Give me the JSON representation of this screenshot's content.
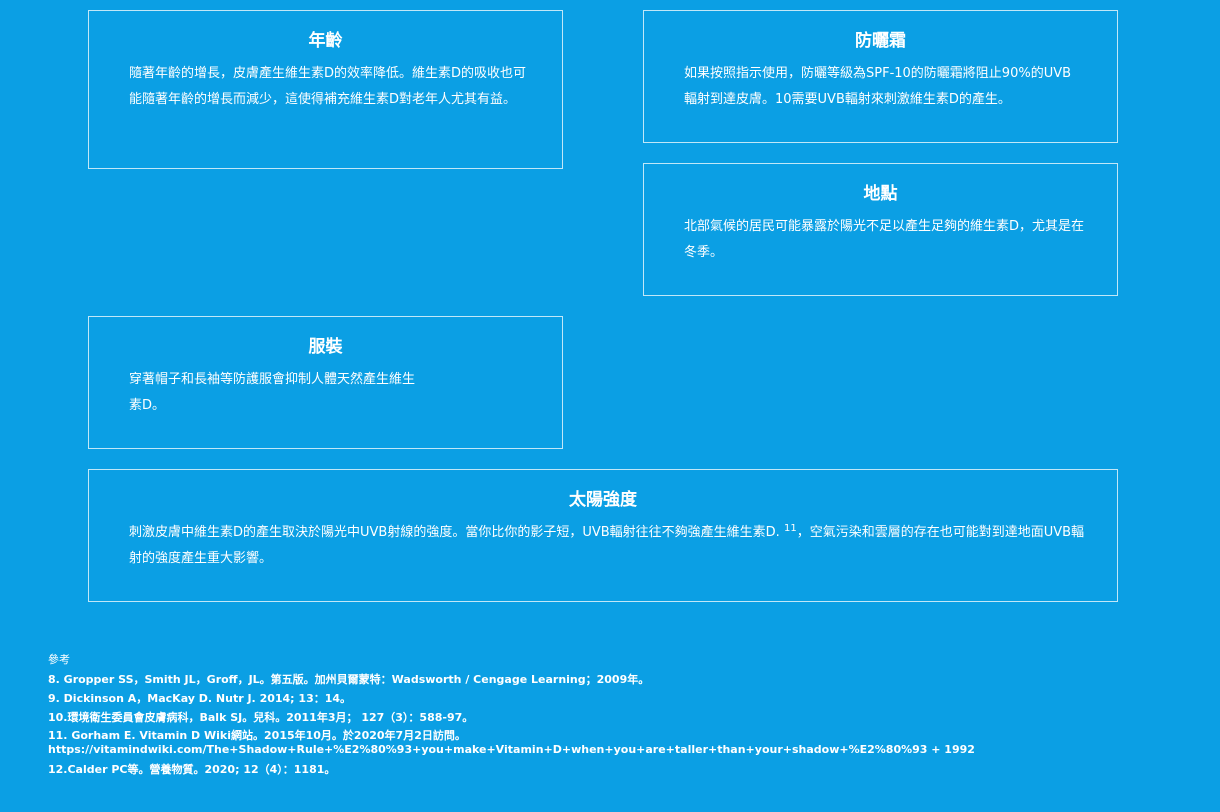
{
  "cards": {
    "age": {
      "title": "年齡",
      "text": "隨著年齡的增長，皮膚產生維生素D的效率降低。維生素D的吸收也可能隨著年齡的增長而減少，這使得補充維生素D對老年人尤其有益。"
    },
    "sunscreen": {
      "title": "防曬霜",
      "text": "如果按照指示使用，防曬等級為SPF-10的防曬霜將阻止90%的UVB輻射到達皮膚。10需要UVB輻射來刺激維生素D的產生。"
    },
    "location": {
      "title": "地點",
      "text": "北部氣候的居民可能暴露於陽光不足以產生足夠的維生素D，尤其是在冬季。"
    },
    "clothing": {
      "title": "服裝",
      "text": "穿著帽子和長袖等防護服會抑制人體天然產生維生素D。"
    },
    "intensity": {
      "title": "太陽強度",
      "text_before": "刺激皮膚中維生素D的產生取決於陽光中UVB射線的強度。當你比你的影子短，UVB輻射往往不夠強產生維生素D.",
      "superscript": "11",
      "text_after": "，空氣污染和雲層的存在也可能對到達地面UVB輻射的強度產生重大影響。"
    }
  },
  "references": {
    "title": "參考",
    "items": [
      "8. Gropper SS，Smith JL，Groff，JL。第五版。加州貝爾蒙特：Wadsworth / Cengage Learning；2009年。",
      "9. Dickinson A，MacKay D. Nutr J. 2014; 13：14。",
      "10.環境衛生委員會皮膚病科，Balk SJ。兒科。2011年3月； 127（3）：588-97。",
      "11. Gorham E. Vitamin D Wiki網站。2015年10月。於2020年7月2日訪問。https://vitamindwiki.com/The+Shadow+Rule+%E2%80%93+you+make+Vitamin+D+when+you+are+taller+than+your+shadow+%E2%80%93 + 1992",
      "12.Calder PC等。營養物質。2020; 12（4）：1181。"
    ]
  },
  "colors": {
    "background": "#0b9fe4",
    "text": "#ffffff"
  }
}
